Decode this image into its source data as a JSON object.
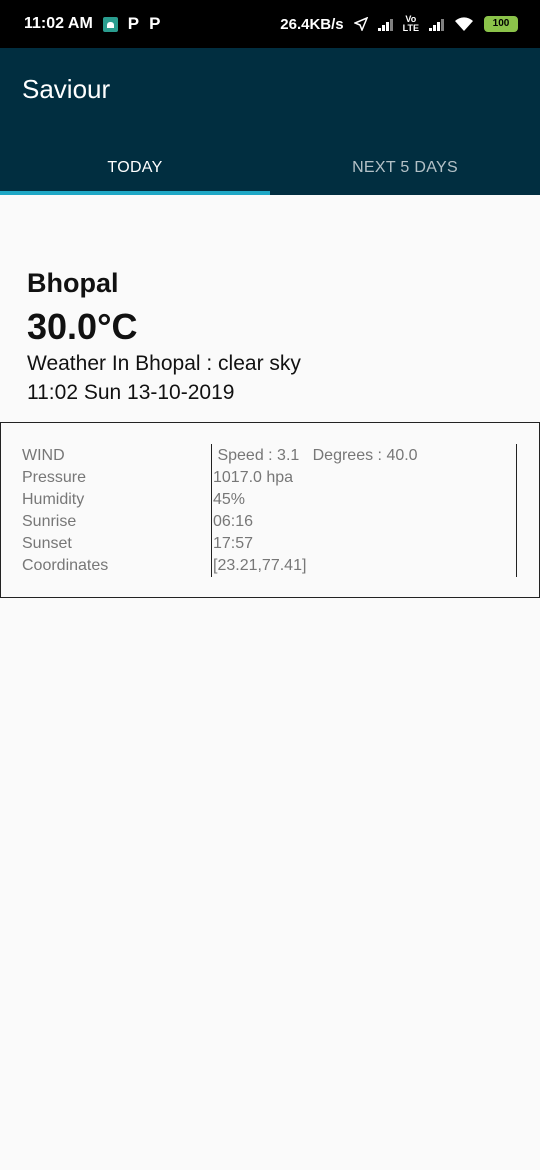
{
  "status_bar": {
    "time": "11:02 AM",
    "speed": "26.4KB/s",
    "battery": "100",
    "volte": "Vo LTE"
  },
  "app": {
    "title": "Saviour",
    "tabs": [
      {
        "label": "TODAY",
        "active": true
      },
      {
        "label": "NEXT 5 DAYS",
        "active": false
      }
    ],
    "colors": {
      "appbar": "#012e40",
      "indicator": "#1ea7c5"
    }
  },
  "weather": {
    "city": "Bhopal",
    "temperature": "30.0°C",
    "description": "Weather In Bhopal : clear sky",
    "datetime": "11:02 Sun 13-10-2019"
  },
  "details": {
    "rows": [
      {
        "label": "WIND",
        "value": " Speed : 3.1   Degrees : 40.0"
      },
      {
        "label": "Pressure",
        "value": "1017.0 hpa"
      },
      {
        "label": "Humidity",
        "value": "45%"
      },
      {
        "label": "Sunrise",
        "value": "06:16"
      },
      {
        "label": "Sunset",
        "value": "17:57"
      },
      {
        "label": "Coordinates",
        "value": "[23.21,77.41]"
      }
    ]
  }
}
